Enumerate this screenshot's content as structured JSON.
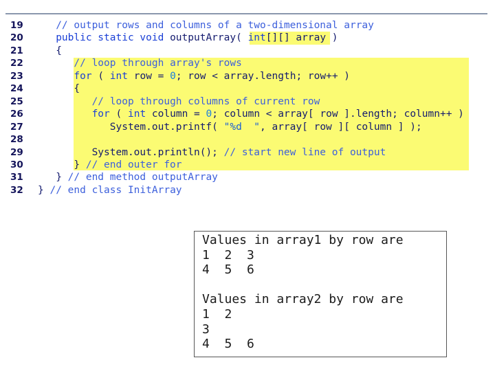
{
  "code_lines": [
    {
      "number": "19",
      "parts": [
        {
          "t": "   "
        },
        {
          "t": "// output rows and columns of a two-dimensional array",
          "c": "cm"
        }
      ]
    },
    {
      "number": "20",
      "parts": [
        {
          "t": "   "
        },
        {
          "t": "public static void",
          "c": "kw"
        },
        {
          "t": " outputArray( "
        },
        {
          "t": "int",
          "c": "kw"
        },
        {
          "t": "[][] array )"
        }
      ]
    },
    {
      "number": "21",
      "parts": [
        {
          "t": "   {"
        }
      ]
    },
    {
      "number": "22",
      "parts": [
        {
          "t": "      "
        },
        {
          "t": "// loop through array's rows",
          "c": "cm"
        }
      ]
    },
    {
      "number": "23",
      "parts": [
        {
          "t": "      "
        },
        {
          "t": "for",
          "c": "kw"
        },
        {
          "t": " ( "
        },
        {
          "t": "int",
          "c": "kw"
        },
        {
          "t": " row = "
        },
        {
          "t": "0",
          "c": "num"
        },
        {
          "t": "; row < array.length; row++ )"
        }
      ]
    },
    {
      "number": "24",
      "parts": [
        {
          "t": "      {"
        }
      ]
    },
    {
      "number": "25",
      "parts": [
        {
          "t": "         "
        },
        {
          "t": "// loop through columns of current row",
          "c": "cm"
        }
      ]
    },
    {
      "number": "26",
      "parts": [
        {
          "t": "         "
        },
        {
          "t": "for",
          "c": "kw"
        },
        {
          "t": " ( "
        },
        {
          "t": "int",
          "c": "kw"
        },
        {
          "t": " column = "
        },
        {
          "t": "0",
          "c": "num"
        },
        {
          "t": "; column < array[ row ].length; column++ )"
        }
      ]
    },
    {
      "number": "27",
      "parts": [
        {
          "t": "            System.out.printf( "
        },
        {
          "t": "\"%d  \"",
          "c": "str"
        },
        {
          "t": ", array[ row ][ column ] );"
        }
      ]
    },
    {
      "number": "28",
      "parts": [
        {
          "t": ""
        }
      ]
    },
    {
      "number": "29",
      "parts": [
        {
          "t": "         System.out.println(); "
        },
        {
          "t": "// start new line of output",
          "c": "cm"
        }
      ]
    },
    {
      "number": "30",
      "parts": [
        {
          "t": "      } "
        },
        {
          "t": "// end outer for",
          "c": "cm"
        }
      ]
    },
    {
      "number": "31",
      "parts": [
        {
          "t": "   } "
        },
        {
          "t": "// end method outputArray",
          "c": "cm"
        }
      ]
    },
    {
      "number": "32",
      "parts": [
        {
          "t": "} "
        },
        {
          "t": "// end class InitArray",
          "c": "cm"
        }
      ]
    }
  ],
  "output_lines": [
    "Values in array1 by row are",
    "1  2  3",
    "4  5  6",
    "",
    "Values in array2 by row are",
    "1  2",
    "3",
    "4  5  6"
  ]
}
